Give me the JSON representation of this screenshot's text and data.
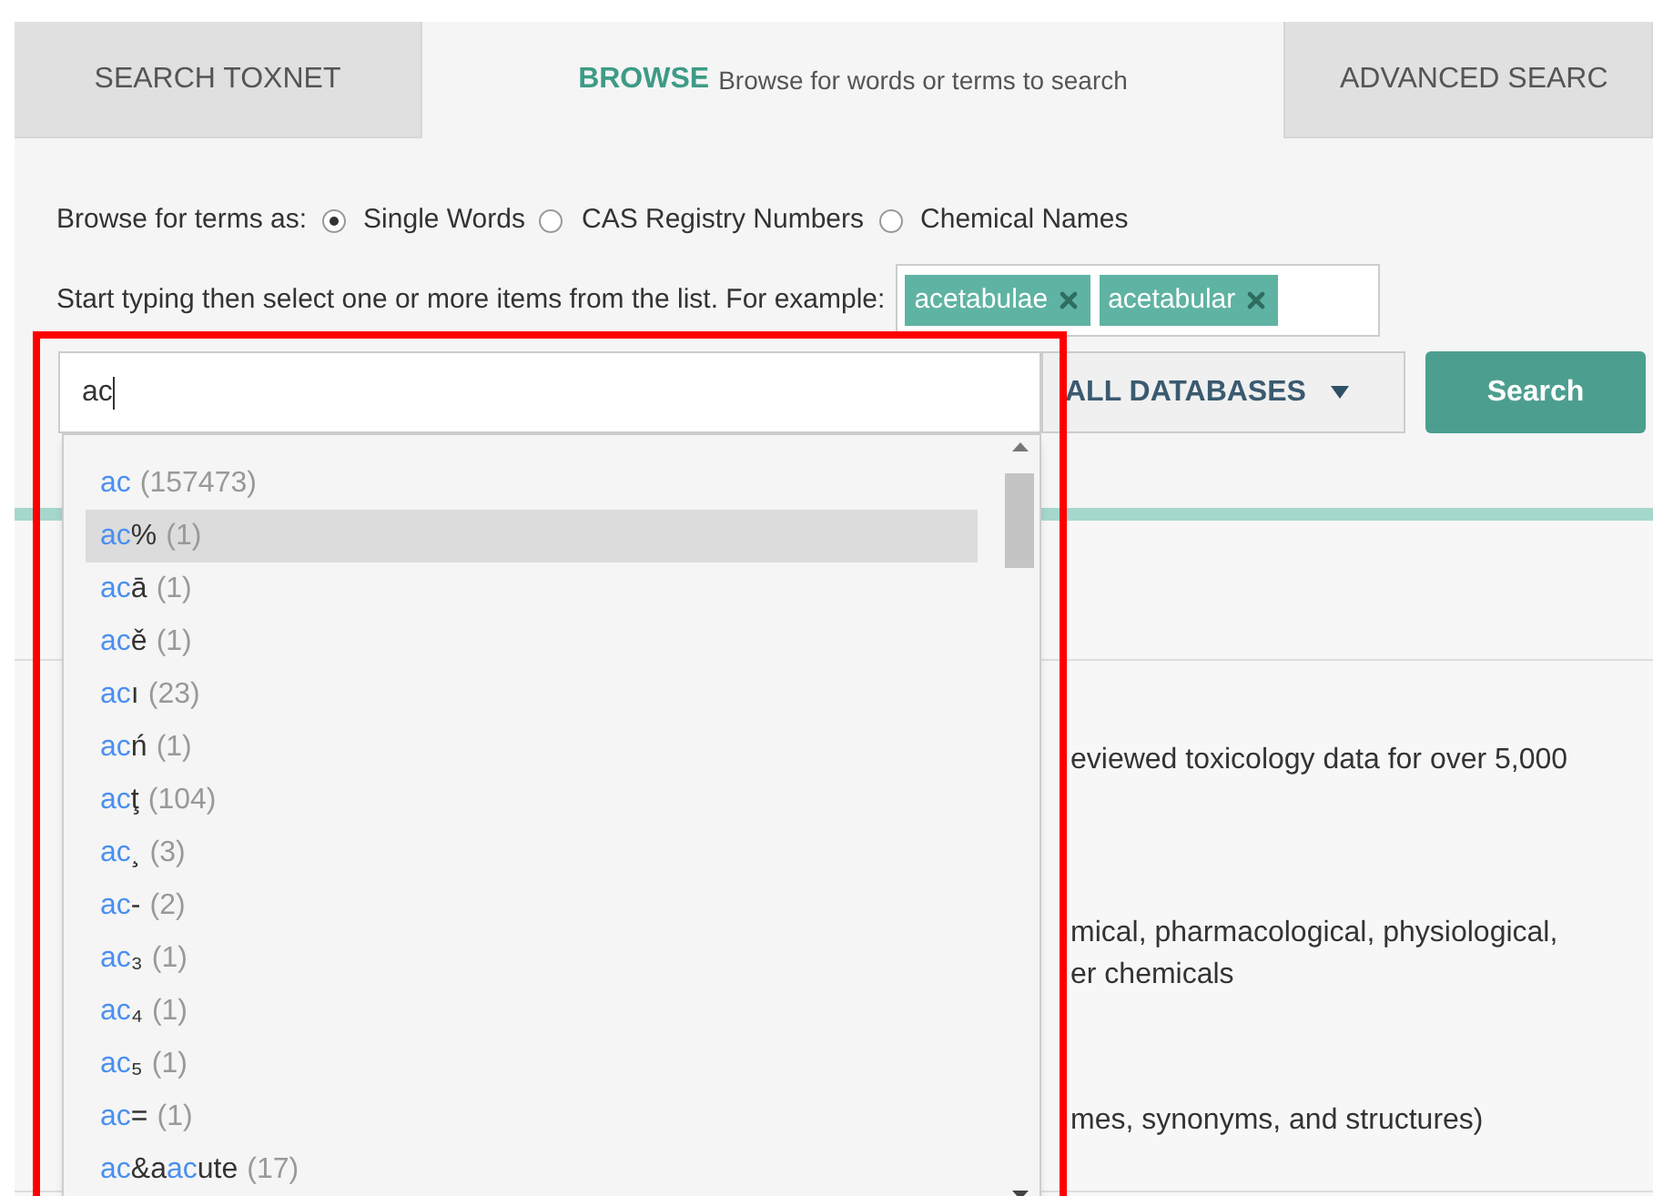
{
  "tabs": [
    {
      "label": "SEARCH TOXNET",
      "selected": false
    },
    {
      "label": "BROWSE",
      "subtitle": "Browse for words or terms to search",
      "selected": true
    },
    {
      "label": "ADVANCED SEARC",
      "selected": false
    }
  ],
  "browse": {
    "label": "Browse for terms as:",
    "options": [
      {
        "label": "Single Words",
        "selected": true
      },
      {
        "label": "CAS Registry Numbers",
        "selected": false
      },
      {
        "label": "Chemical Names",
        "selected": false
      }
    ]
  },
  "example": {
    "label": "Start typing then select one or more items from the list. For example:",
    "tags": [
      "acetabulae",
      "acetabular"
    ]
  },
  "search_field": {
    "value": "ac"
  },
  "database_menu": {
    "label": "ALL DATABASES"
  },
  "search_button": {
    "label": "Search"
  },
  "suggestions": [
    {
      "parts": [
        {
          "text": "ac",
          "match": true
        }
      ],
      "count": "(157473)",
      "selected": false
    },
    {
      "parts": [
        {
          "text": "ac",
          "match": true
        },
        {
          "text": "%",
          "match": false
        }
      ],
      "count": "(1)",
      "selected": true
    },
    {
      "parts": [
        {
          "text": "ac",
          "match": true
        },
        {
          "text": "ā",
          "match": false
        }
      ],
      "count": "(1)",
      "selected": false
    },
    {
      "parts": [
        {
          "text": "ac",
          "match": true
        },
        {
          "text": "ě",
          "match": false
        }
      ],
      "count": "(1)",
      "selected": false
    },
    {
      "parts": [
        {
          "text": "ac",
          "match": true
        },
        {
          "text": "ı",
          "match": false
        }
      ],
      "count": "(23)",
      "selected": false
    },
    {
      "parts": [
        {
          "text": "ac",
          "match": true
        },
        {
          "text": "ń",
          "match": false
        }
      ],
      "count": "(1)",
      "selected": false
    },
    {
      "parts": [
        {
          "text": "ac",
          "match": true
        },
        {
          "text": "ţ",
          "match": false
        }
      ],
      "count": "(104)",
      "selected": false
    },
    {
      "parts": [
        {
          "text": "ac",
          "match": true
        },
        {
          "text": "¸",
          "match": false
        }
      ],
      "count": "(3)",
      "selected": false
    },
    {
      "parts": [
        {
          "text": "ac",
          "match": true
        },
        {
          "text": "-",
          "match": false
        }
      ],
      "count": "(2)",
      "selected": false
    },
    {
      "parts": [
        {
          "text": "ac",
          "match": true
        },
        {
          "text": "₃",
          "match": false
        }
      ],
      "count": "(1)",
      "selected": false
    },
    {
      "parts": [
        {
          "text": "ac",
          "match": true
        },
        {
          "text": "₄",
          "match": false
        }
      ],
      "count": "(1)",
      "selected": false
    },
    {
      "parts": [
        {
          "text": "ac",
          "match": true
        },
        {
          "text": "₅",
          "match": false
        }
      ],
      "count": "(1)",
      "selected": false
    },
    {
      "parts": [
        {
          "text": "ac",
          "match": true
        },
        {
          "text": "=",
          "match": false
        }
      ],
      "count": "(1)",
      "selected": false
    },
    {
      "parts": [
        {
          "text": "ac",
          "match": true
        },
        {
          "text": "&a",
          "match": false
        },
        {
          "text": "ac",
          "match": true
        },
        {
          "text": "ute",
          "match": false
        }
      ],
      "count": "(17)",
      "selected": false
    }
  ],
  "background_text": [
    {
      "lines": [
        "eviewed toxicology data for over 5,000"
      ]
    },
    {
      "lines": [
        "mical, pharmacological, physiological,",
        "er chemicals"
      ]
    },
    {
      "lines": [
        "mes, synonyms, and structures)"
      ]
    }
  ]
}
